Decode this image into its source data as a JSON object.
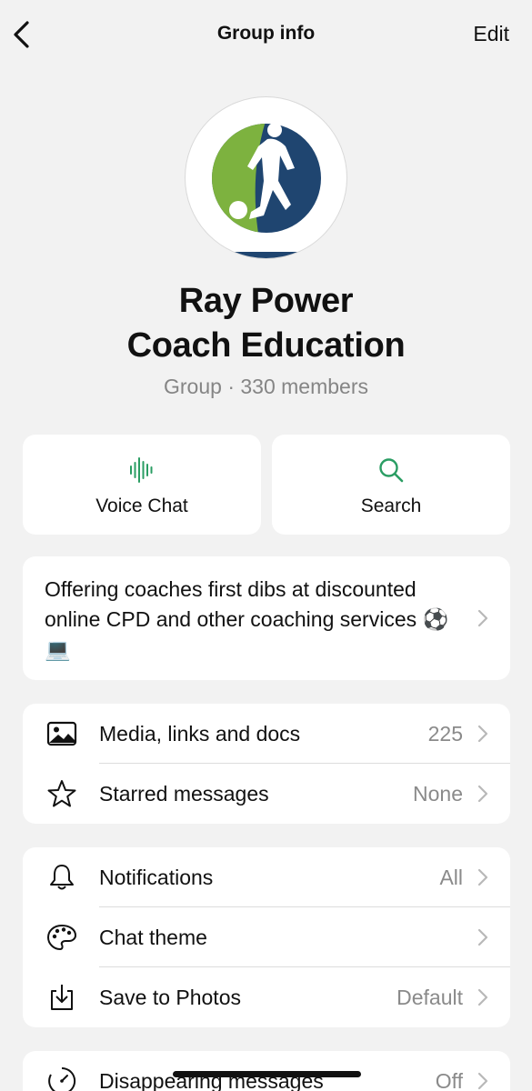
{
  "header": {
    "title": "Group info",
    "edit_label": "Edit"
  },
  "group": {
    "name_line1": "Ray Power",
    "name_line2": "Coach Education",
    "subtitle": "Group · 330 members"
  },
  "actions": [
    {
      "label": "Voice Chat",
      "icon": "voice-wave-icon"
    },
    {
      "label": "Search",
      "icon": "search-icon"
    }
  ],
  "description": {
    "text": "Offering coaches first dibs at discounted online CPD and other coaching services ⚽️ 💻"
  },
  "section1": [
    {
      "label": "Media, links and docs",
      "value": "225",
      "icon": "image-icon"
    },
    {
      "label": "Starred messages",
      "value": "None",
      "icon": "star-icon"
    }
  ],
  "section2": [
    {
      "label": "Notifications",
      "value": "All",
      "icon": "bell-icon"
    },
    {
      "label": "Chat theme",
      "value": "",
      "icon": "palette-icon"
    },
    {
      "label": "Save to Photos",
      "value": "Default",
      "icon": "download-icon"
    }
  ],
  "section3": [
    {
      "label": "Disappearing messages",
      "value": "Off",
      "icon": "timer-icon"
    }
  ],
  "colors": {
    "accent": "#2a9d63",
    "avatar_green": "#7db23f",
    "avatar_navy": "#1f4570"
  }
}
